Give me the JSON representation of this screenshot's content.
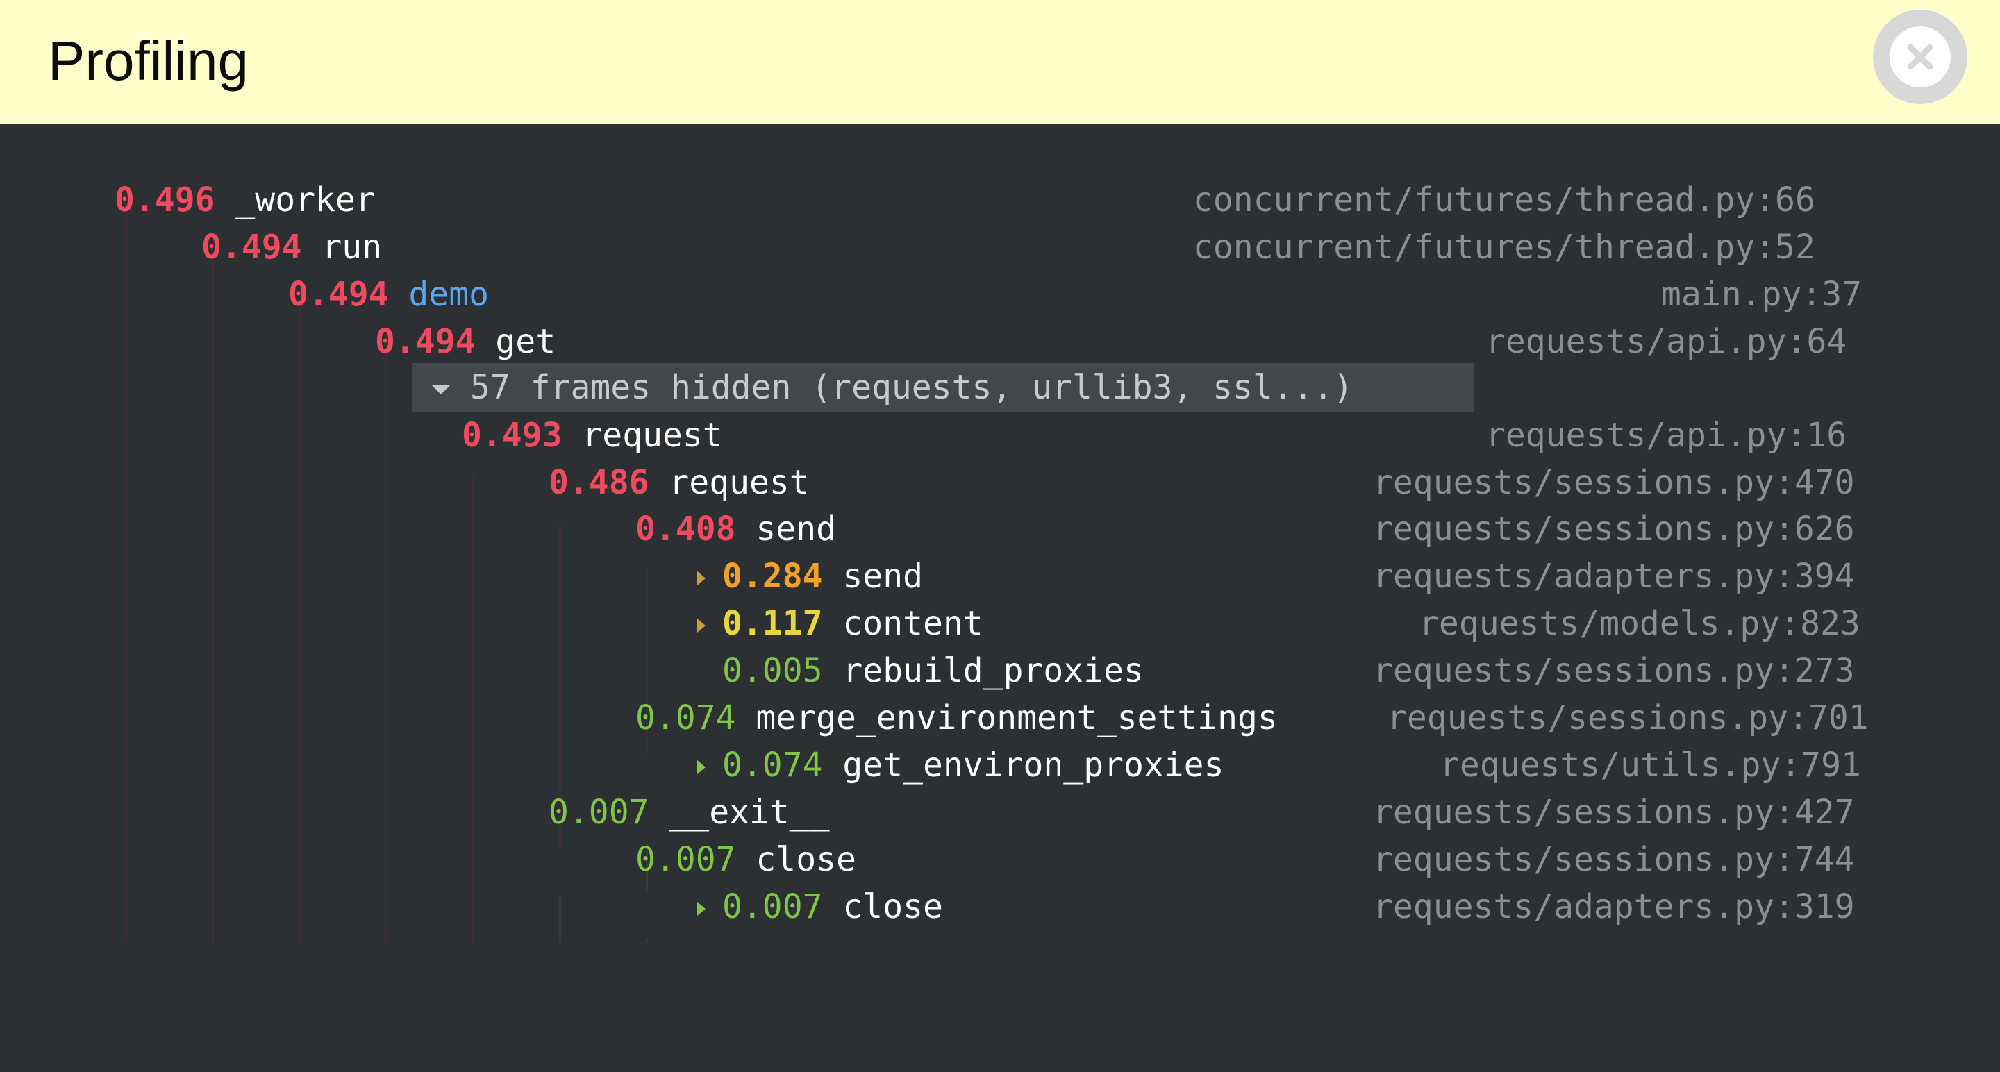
{
  "header": {
    "title": "Profiling"
  },
  "hidden_frames": {
    "label": "57 frames hidden (requests, urllib3, ssl...)"
  },
  "rows": [
    {
      "time": "0.496",
      "name": "_worker",
      "location": "concurrent/futures/thread.py:66"
    },
    {
      "time": "0.494",
      "name": "run",
      "location": "concurrent/futures/thread.py:52"
    },
    {
      "time": "0.494",
      "name": "demo",
      "location": "main.py:37"
    },
    {
      "time": "0.494",
      "name": "get",
      "location": "requests/api.py:64"
    },
    {
      "time": "0.493",
      "name": "request",
      "location": "requests/api.py:16"
    },
    {
      "time": "0.486",
      "name": "request",
      "location": "requests/sessions.py:470"
    },
    {
      "time": "0.408",
      "name": "send",
      "location": "requests/sessions.py:626"
    },
    {
      "time": "0.284",
      "name": "send",
      "location": "requests/adapters.py:394"
    },
    {
      "time": "0.117",
      "name": "content",
      "location": "requests/models.py:823"
    },
    {
      "time": "0.005",
      "name": "rebuild_proxies",
      "location": "requests/sessions.py:273"
    },
    {
      "time": "0.074",
      "name": "merge_environment_settings",
      "location": "requests/sessions.py:701"
    },
    {
      "time": "0.074",
      "name": "get_environ_proxies",
      "location": "requests/utils.py:791"
    },
    {
      "time": "0.007",
      "name": "__exit__",
      "location": "requests/sessions.py:427"
    },
    {
      "time": "0.007",
      "name": "close",
      "location": "requests/sessions.py:744"
    },
    {
      "time": "0.007",
      "name": "close",
      "location": "requests/adapters.py:319"
    }
  ]
}
